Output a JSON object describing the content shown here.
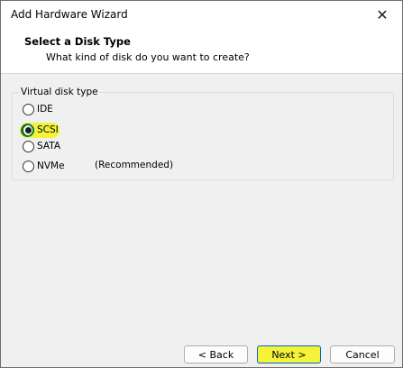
{
  "window": {
    "title": "Add Hardware Wizard",
    "close_glyph": "✕"
  },
  "header": {
    "title": "Select a Disk Type",
    "subtitle": "What kind of disk do you want to create?"
  },
  "group": {
    "label": "Virtual disk type",
    "options": [
      {
        "label": "IDE",
        "checked": false
      },
      {
        "label": "SCSI",
        "checked": true
      },
      {
        "label": "SATA",
        "checked": false
      },
      {
        "label": "NVMe",
        "checked": false,
        "note": "(Recommended)"
      }
    ]
  },
  "buttons": {
    "back": "< Back",
    "next": "Next >",
    "cancel": "Cancel"
  },
  "colors": {
    "highlight": "#f4f33a",
    "accent": "#0067c0"
  }
}
